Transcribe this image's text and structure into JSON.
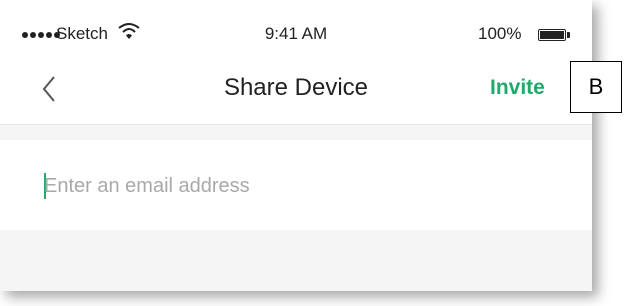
{
  "status_bar": {
    "carrier": "Sketch",
    "time": "9:41 AM",
    "battery": "100%"
  },
  "nav": {
    "title": "Share Device",
    "action_label": "Invite",
    "back_icon": "chevron-left-icon"
  },
  "form": {
    "email_placeholder": "Enter an email address",
    "email_value": ""
  },
  "annotation": {
    "label": "B"
  },
  "colors": {
    "accent": "#23a86b",
    "background": "#f5f5f5"
  }
}
